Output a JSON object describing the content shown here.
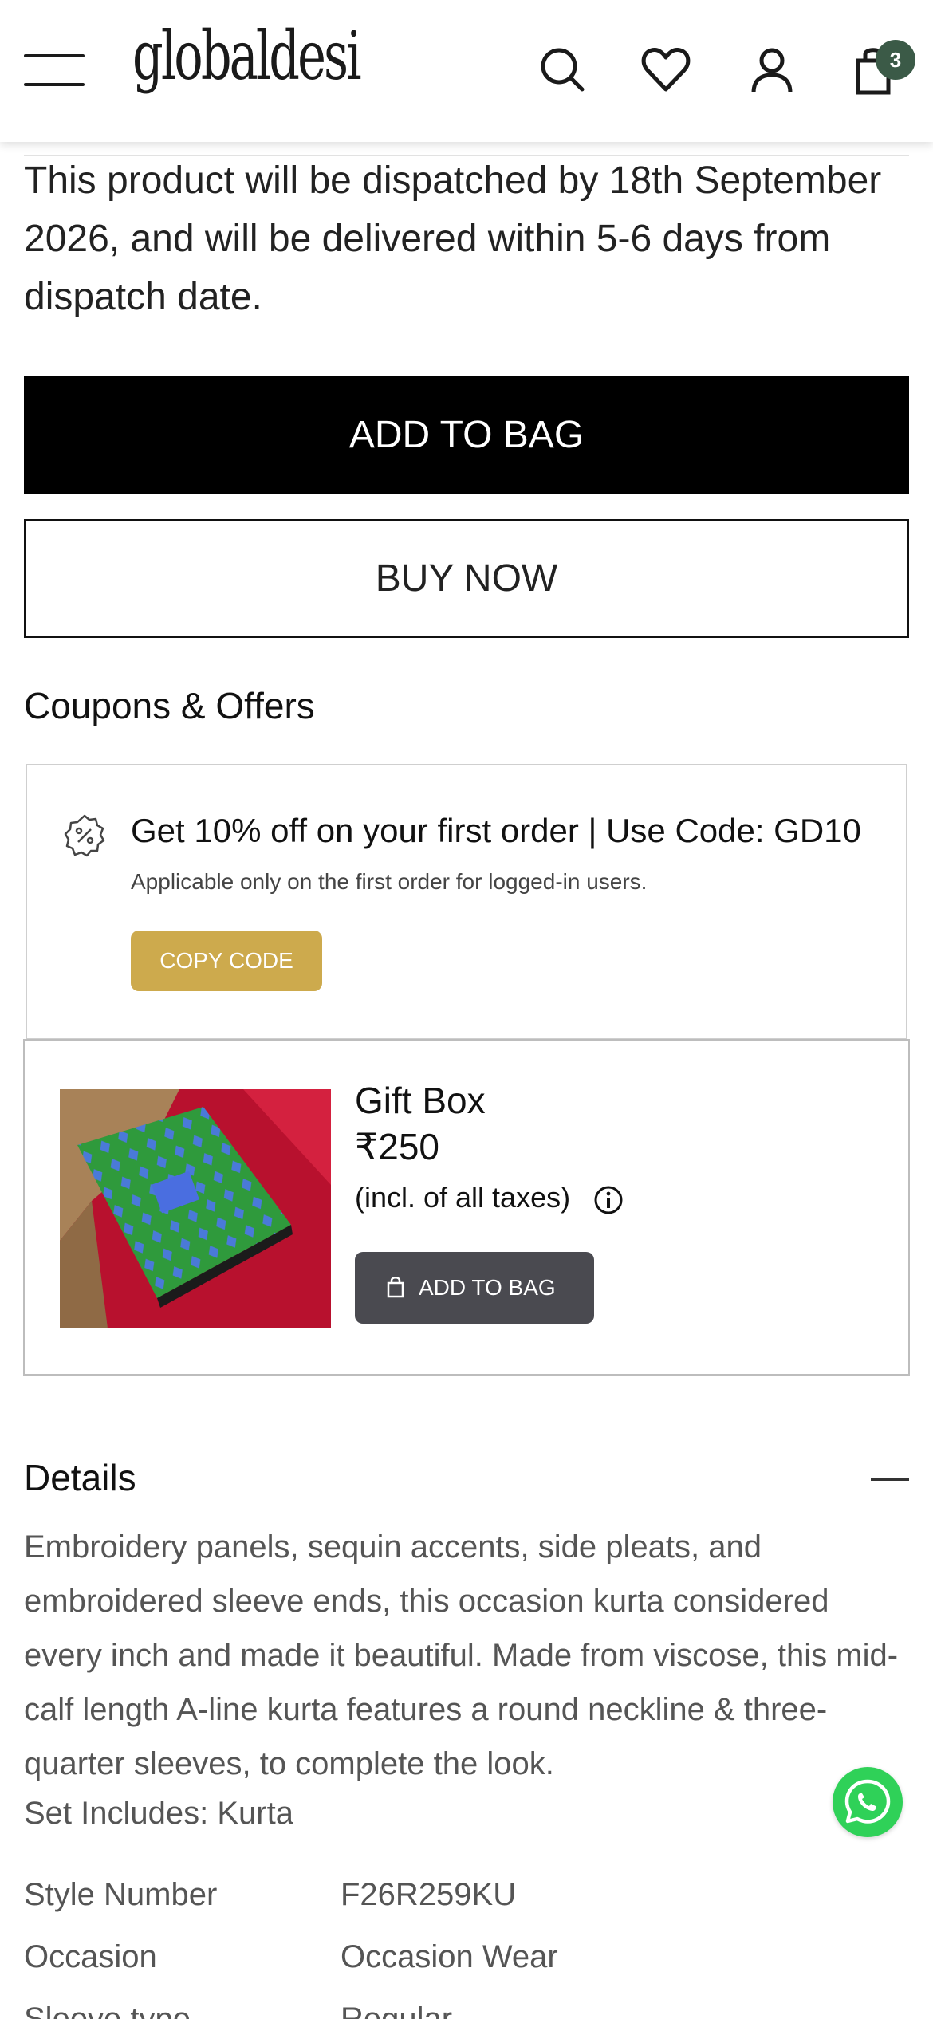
{
  "header": {
    "logo": "globaldesi",
    "cart_count": "3",
    "icons": [
      "menu-icon",
      "search-icon",
      "heart-icon",
      "user-icon",
      "bag-icon"
    ]
  },
  "dispatch_note": "This product will be dispatched by 18th September 2026, and will be delivered within 5-6 days from dispatch date.",
  "actions": {
    "add_to_bag": "ADD TO BAG",
    "buy_now": "BUY NOW"
  },
  "coupons": {
    "title": "Coupons & Offers",
    "offer_title": "Get 10% off on your first order | Use Code: GD10",
    "offer_sub": "Applicable only on the first order for logged-in users.",
    "copy_label": "COPY CODE",
    "accent_color": "#cdaa4d"
  },
  "gift": {
    "name": "Gift Box",
    "price": "₹250",
    "tax_note": "(incl. of all taxes)",
    "add_label": "ADD TO BAG"
  },
  "details": {
    "title": "Details",
    "description": "Embroidery panels, sequin accents, side pleats, and embroidered sleeve ends, this occasion kurta considered every inch and made it beautiful. Made from viscose, this mid-calf length A-line kurta features a round neckline & three-quarter sleeves, to complete the look.",
    "set_includes": "Set Includes: Kurta",
    "specs": [
      {
        "label": "Style Number",
        "value": "F26R259KU"
      },
      {
        "label": "Occasion",
        "value": "Occasion Wear"
      },
      {
        "label": "Sleeve type",
        "value": "Regular"
      }
    ]
  }
}
